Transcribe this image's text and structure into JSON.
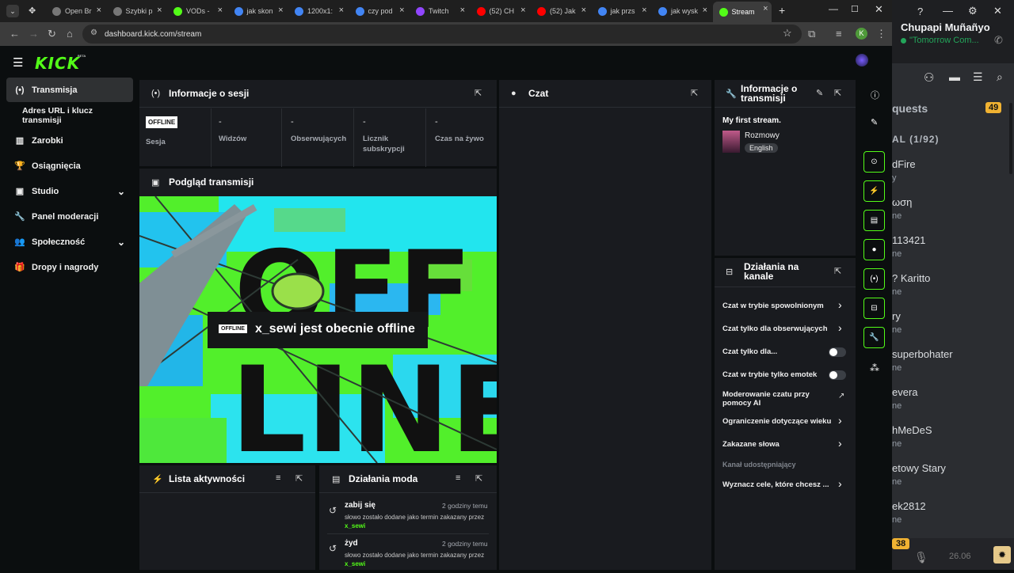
{
  "browser": {
    "tabs": [
      {
        "label": "Open Br",
        "color": "#777777"
      },
      {
        "label": "Szybki p",
        "color": "#777777"
      },
      {
        "label": "VODs -",
        "color": "#53fc18"
      },
      {
        "label": "jak skon",
        "color": "#4285f4"
      },
      {
        "label": "1200x1:",
        "color": "#4285f4"
      },
      {
        "label": "czy pod",
        "color": "#4285f4"
      },
      {
        "label": "Twitch",
        "color": "#9146ff"
      },
      {
        "label": "(52) CH",
        "color": "#ff0000"
      },
      {
        "label": "(52) Jak",
        "color": "#ff0000"
      },
      {
        "label": "jak przs",
        "color": "#4285f4"
      },
      {
        "label": "jak wysk",
        "color": "#4285f4"
      },
      {
        "label": "Stream",
        "color": "#53fc18"
      }
    ],
    "url": "dashboard.kick.com/stream",
    "profile_initial": "K"
  },
  "logo": {
    "text": "KICK",
    "beta": "BETA"
  },
  "sidebar": {
    "items": [
      {
        "label": "Transmisja",
        "icon": "broadcast-icon"
      },
      {
        "label": "Adres URL i klucz transmisji",
        "icon": ""
      },
      {
        "label": "Zarobki",
        "icon": "chart-icon"
      },
      {
        "label": "Osiągnięcia",
        "icon": "trophy-icon"
      },
      {
        "label": "Studio",
        "icon": "studio-icon"
      },
      {
        "label": "Panel moderacji",
        "icon": "wrench-icon"
      },
      {
        "label": "Społeczność",
        "icon": "community-icon"
      },
      {
        "label": "Dropy i nagrody",
        "icon": "gift-icon"
      }
    ]
  },
  "session": {
    "title": "Informacje o sesji",
    "badge": "OFFLINE",
    "stats": [
      {
        "value": "",
        "label": "Sesja"
      },
      {
        "value": "-",
        "label": "Widzów"
      },
      {
        "value": "-",
        "label": "Obserwujących"
      },
      {
        "value": "-",
        "label": "Licznik subskrypcji"
      },
      {
        "value": "-",
        "label": "Czas na żywo"
      }
    ]
  },
  "preview": {
    "title": "Podgląd transmisji",
    "art_text_top": "OFF",
    "art_text_bottom": "LINE",
    "badge": "OFFLINE",
    "message": "x_sewi jest obecnie offline"
  },
  "chat": {
    "title": "Czat"
  },
  "stream_info": {
    "title": "Informacje o transmisji",
    "stream_title": "My first stream.",
    "category": "Rozmowy",
    "language": "English"
  },
  "channel_actions": {
    "title": "Działania na kanale",
    "items": [
      {
        "label": "Czat w trybie spowolnionym",
        "control": "chevron"
      },
      {
        "label": "Czat tylko dla obserwujących",
        "control": "chevron"
      },
      {
        "label": "Czat tylko dla...",
        "control": "toggle"
      },
      {
        "label": "Czat w trybie tylko emotek",
        "control": "toggle"
      },
      {
        "label": "Moderowanie czatu przy pomocy AI",
        "control": "external"
      },
      {
        "label": "Ograniczenie dotyczące wieku",
        "control": "chevron"
      },
      {
        "label": "Zakazane słowa",
        "control": "chevron"
      },
      {
        "label": "Kanał udostępniający",
        "control": "none"
      },
      {
        "label": "Wyznacz cele, które chcesz ...",
        "control": "chevron"
      }
    ]
  },
  "activity": {
    "title": "Lista aktywności"
  },
  "mod_actions": {
    "title": "Działania moda",
    "entries": [
      {
        "word": "zabij się",
        "time": "2 godziny temu",
        "desc": "słowo zostało dodane jako termin zakazany przez",
        "user": "x_sewi"
      },
      {
        "word": "żyd",
        "time": "2 godziny temu",
        "desc": "słowo zostało dodane jako termin zakazany przez",
        "user": "x_sewi"
      }
    ]
  },
  "discord": {
    "username": "Chupapi Muñañyo",
    "status": "\"Tomorrow Com...",
    "requests_label": "quests",
    "requests_count": "49",
    "section": "AL (1/92)",
    "members": [
      {
        "name": "dFire",
        "sub": "y"
      },
      {
        "name": "ωση",
        "sub": "ne"
      },
      {
        "name": "113421",
        "sub": "ne"
      },
      {
        "name": "? Karitto",
        "sub": "ne"
      },
      {
        "name": "ry",
        "sub": "ne"
      },
      {
        "name": "superbohater",
        "sub": "ne"
      },
      {
        "name": "evera",
        "sub": "ne"
      },
      {
        "name": "hMeDeS",
        "sub": "ne"
      },
      {
        "name": "etowy Stary",
        "sub": "ne"
      },
      {
        "name": "ek2812",
        "sub": "ne"
      }
    ],
    "badge_count": "38",
    "time": "26.06"
  },
  "colors": {
    "accent": "#53fc18",
    "panel": "#191b1f",
    "bg": "#0b0e0f"
  }
}
